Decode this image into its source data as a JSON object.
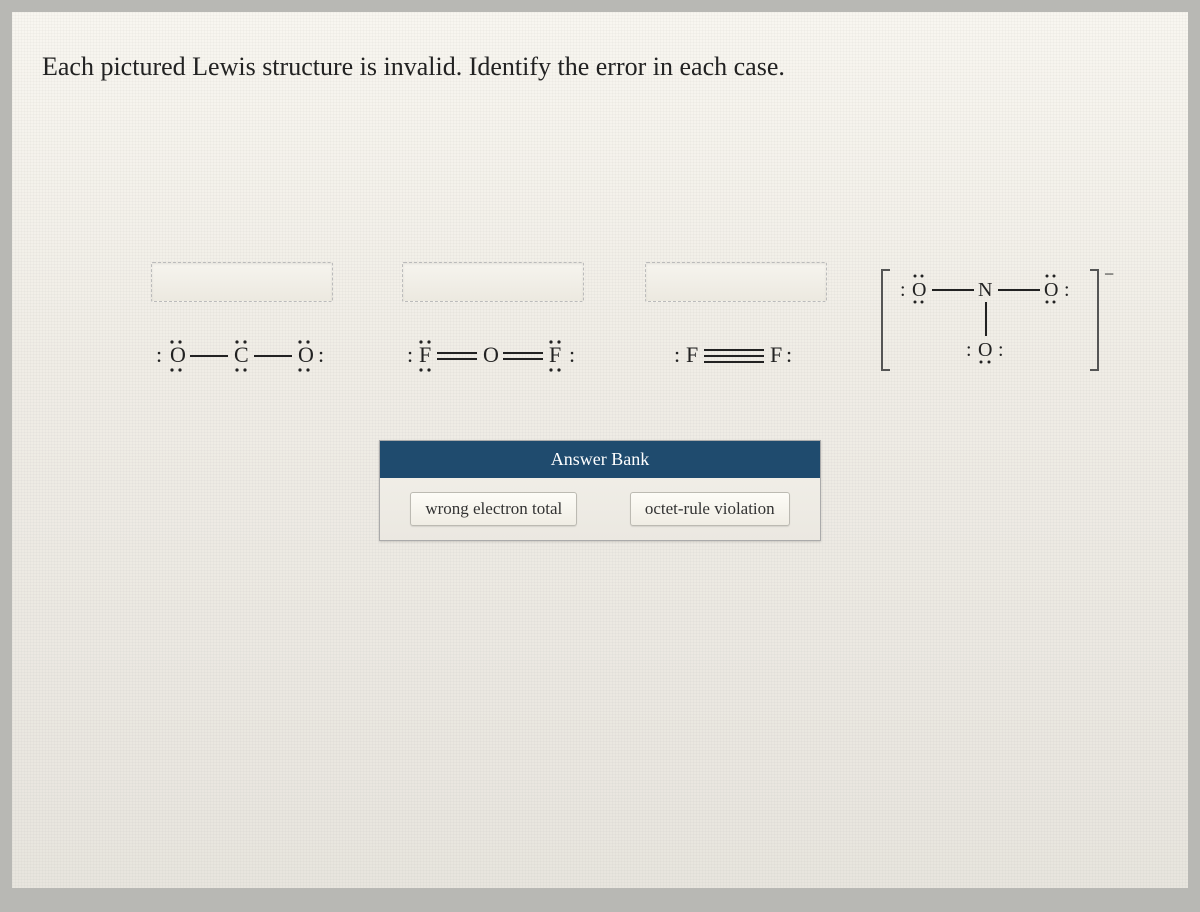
{
  "instruction": "Each pictured Lewis structure is invalid. Identify the error in each case.",
  "structures": [
    {
      "id": "co2-like",
      "formula_hint": "O–C–O single bonds with many lone pairs"
    },
    {
      "id": "of2-like",
      "formula_hint": "F=O=F double bonds"
    },
    {
      "id": "f2-like",
      "formula_hint": "F≡F triple bond"
    },
    {
      "id": "no3-like",
      "formula_hint": "[O–N(–O)–O]⁻"
    }
  ],
  "answer_bank": {
    "title": "Answer Bank",
    "options": [
      "wrong electron total",
      "octet-rule violation"
    ]
  }
}
